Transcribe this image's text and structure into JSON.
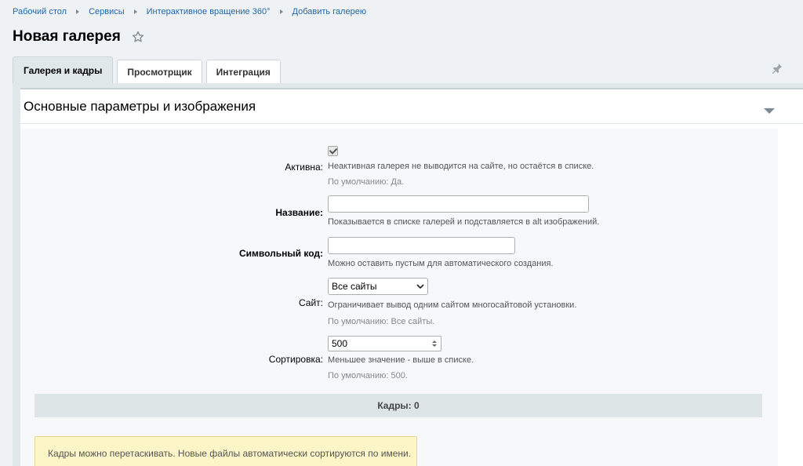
{
  "breadcrumb": [
    "Рабочий стол",
    "Сервисы",
    "Интерактивное вращение 360°",
    "Добавить галерею"
  ],
  "page": {
    "title": "Новая галерея"
  },
  "tabs": [
    {
      "label": "Галерея и кадры",
      "active": true
    },
    {
      "label": "Просмотрщик",
      "active": false
    },
    {
      "label": "Интеграция",
      "active": false
    }
  ],
  "section": {
    "title": "Основные параметры и изображения"
  },
  "form": {
    "active": {
      "label": "Активна:",
      "checked": true,
      "hint": "Неактивная галерея не выводится на сайте, но остаётся в списке.",
      "default": "По умолчанию: Да."
    },
    "name": {
      "label": "Название:",
      "value": "",
      "hint": "Показывается в списке галерей и подставляется в alt изображений."
    },
    "code": {
      "label": "Символьный код:",
      "value": "",
      "hint": "Можно оставить пустым для автоматического создания."
    },
    "site": {
      "label": "Сайт:",
      "value": "Все сайты",
      "hint": "Ограничивает вывод одним сайтом многосайтовой установки.",
      "default": "По умолчанию: Все сайты."
    },
    "sort": {
      "label": "Сортировка:",
      "value": "500",
      "hint": "Меньшее значение - выше в списке.",
      "default": "По умолчанию: 500."
    }
  },
  "frames": {
    "label": "Кадры: 0"
  },
  "notice": {
    "text": "Кадры можно перетаскивать. Новые файлы автоматически сортируются по имени."
  },
  "colors": {
    "link": "#2067b0",
    "panel": "#e0e8ea",
    "notice_bg": "#fbf5c8"
  }
}
